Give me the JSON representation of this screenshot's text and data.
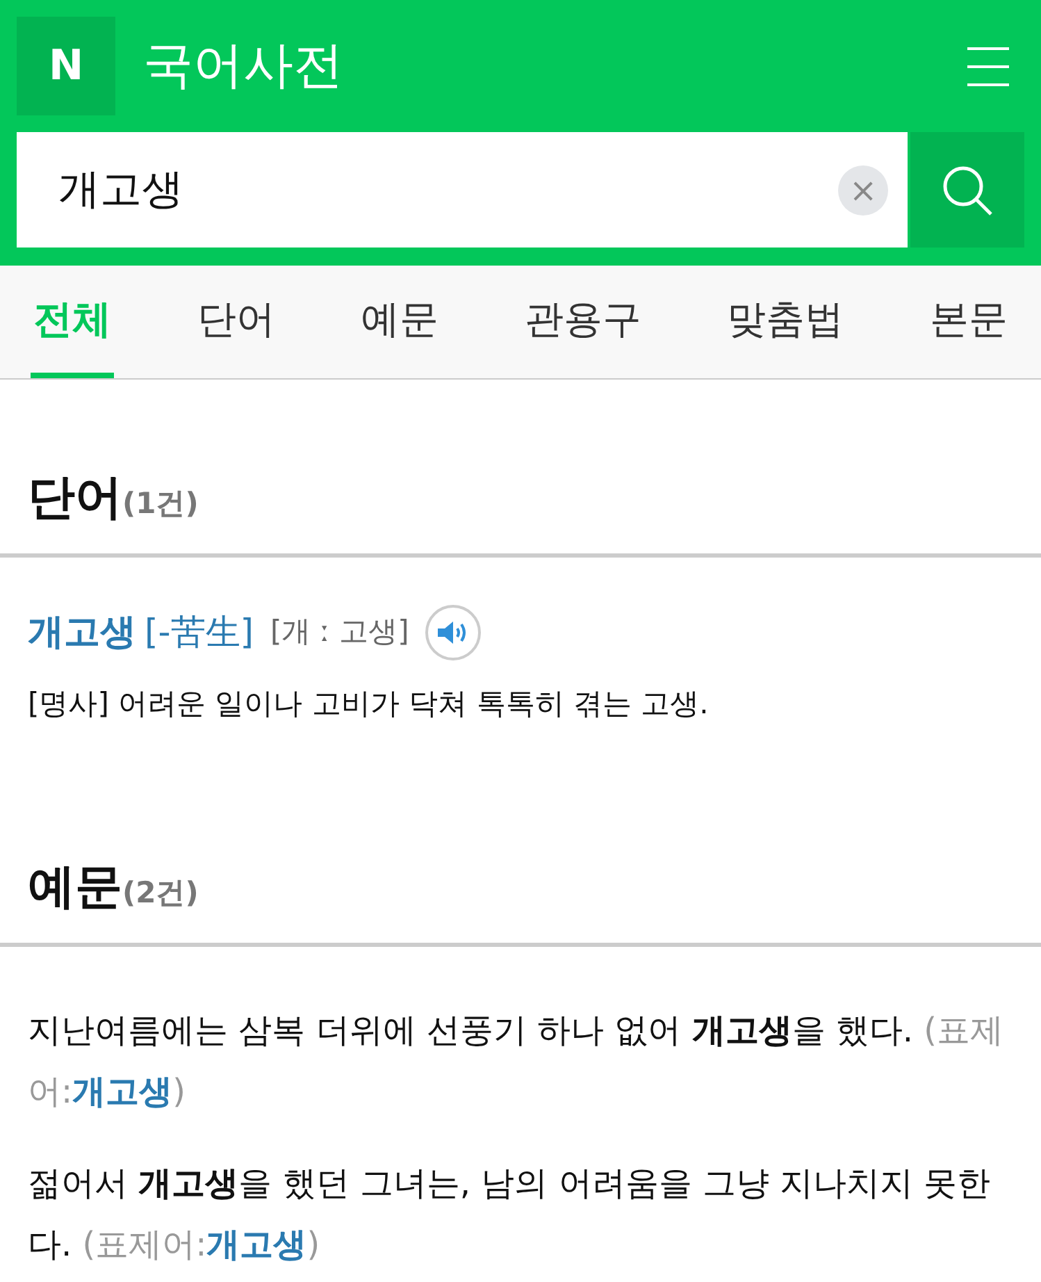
{
  "header": {
    "logo": "N",
    "title": "국어사전"
  },
  "search": {
    "value": "개고생",
    "clear": "×"
  },
  "tabs": [
    {
      "label": "전체",
      "selected": true
    },
    {
      "label": "단어",
      "selected": false
    },
    {
      "label": "예문",
      "selected": false
    },
    {
      "label": "관용구",
      "selected": false
    },
    {
      "label": "맞춤법",
      "selected": false
    },
    {
      "label": "본문",
      "selected": false
    }
  ],
  "word_section": {
    "title": "단어",
    "count": "(1건)",
    "entries": [
      {
        "headword": "개고생",
        "hanja": "[-苦生]",
        "pronunciation": "[개 ː 고생]",
        "definition": "[명사] 어려운 일이나 고비가 닥쳐 톡톡히 겪는 고생."
      }
    ]
  },
  "example_section": {
    "title": "예문",
    "count": "(2건)",
    "examples": [
      {
        "sentence": "지난여름에는 삼복 더위에 선풍기 하나 없어 **개고생**을 했다.",
        "source_prefix": "(표제어:",
        "source_word": "개고생",
        "source_suffix": ")"
      },
      {
        "sentence": "젊어서 **개고생**을 했던 그녀는, 남의 어려움을 그냥 지나치지 못한다.",
        "source_prefix": "(표제어:",
        "source_word": "개고생",
        "source_suffix": ")"
      }
    ]
  }
}
